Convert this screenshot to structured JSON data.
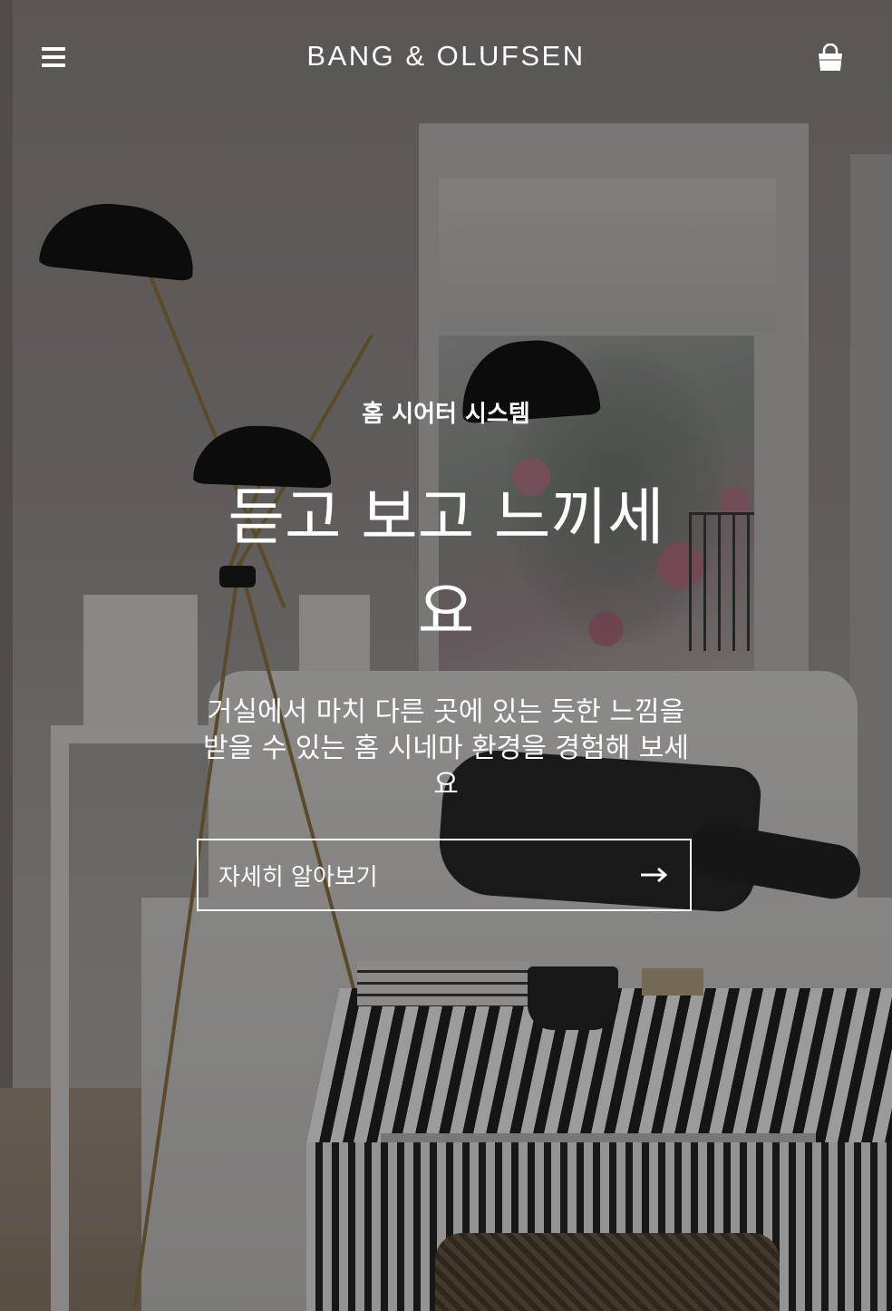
{
  "header": {
    "menu_icon": "hamburger-menu-icon",
    "brand": "BANG & OLUFSEN",
    "cart_icon": "shopping-bag-icon"
  },
  "hero": {
    "eyebrow": "홈 시어터 시스템",
    "headline": "듣고 보고 느끼세요",
    "description": "거실에서 마치 다른 곳에 있는 듯한 느낌을 받을 수 있는 홈 시네마 환경을 경험해 보세요",
    "cta_label": "자세히 알아보기",
    "cta_icon": "arrow-right-icon"
  },
  "colors": {
    "text": "#ffffff",
    "overlay": "rgba(0,0,0,0.36)"
  }
}
